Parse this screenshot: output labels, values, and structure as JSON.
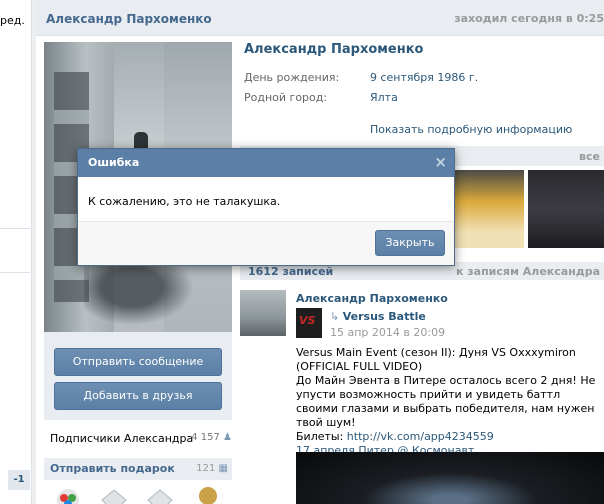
{
  "left_strip": {
    "red_label": "ред.",
    "minus_badge": "-1"
  },
  "header": {
    "name": "Александр Пархоменко",
    "last_seen": "заходил сегодня в 0:25"
  },
  "profile": {
    "title": "Александр Пархоменко",
    "fields": [
      {
        "key": "День рождения:",
        "value": "9 сентября 1986 г."
      },
      {
        "key": "Родной город:",
        "value": "Ялта"
      }
    ],
    "more_link": "Показать подробную информацию"
  },
  "actions": {
    "send_message": "Отправить сообщение",
    "add_friend": "Добавить в друзья"
  },
  "subscribers": {
    "label": "Подписчики Александра",
    "count": "4 157"
  },
  "gifts": {
    "label": "Отправить подарок",
    "count": "121"
  },
  "photos": {
    "all_label": "все"
  },
  "wall": {
    "count_label": "1612 записей",
    "to_label": "к записям Александра"
  },
  "post": {
    "author": "Александр Пархоменко",
    "repost_source": "Versus Battle",
    "repost_logo": "VS",
    "date": "15 апр 2014 в 20:09",
    "text_lines": [
      "Versus Main Event (сезон II): Дуня VS Oxxxymiron (OFFICIAL FULL VIDEO)",
      "До Майн Эвента в Питере осталось всего 2 дня! Не упусти возможность прийти и увидеть баттл своими глазами и выбрать победителя, нам нужен твой шум!"
    ],
    "tickets_label": "Билеты: ",
    "tickets_link": "http://vk.com/app4234559",
    "event_line": "17 апреля Питер @ Космонавт"
  },
  "dialog": {
    "title": "Ошибка",
    "message": "К сожалению, это не талакушка.",
    "close_button": "Закрыть",
    "close_icon": "×"
  },
  "colors": {
    "brand_blue": "#5b7fa6",
    "link": "#2b587a",
    "panel": "#e9edf1"
  }
}
